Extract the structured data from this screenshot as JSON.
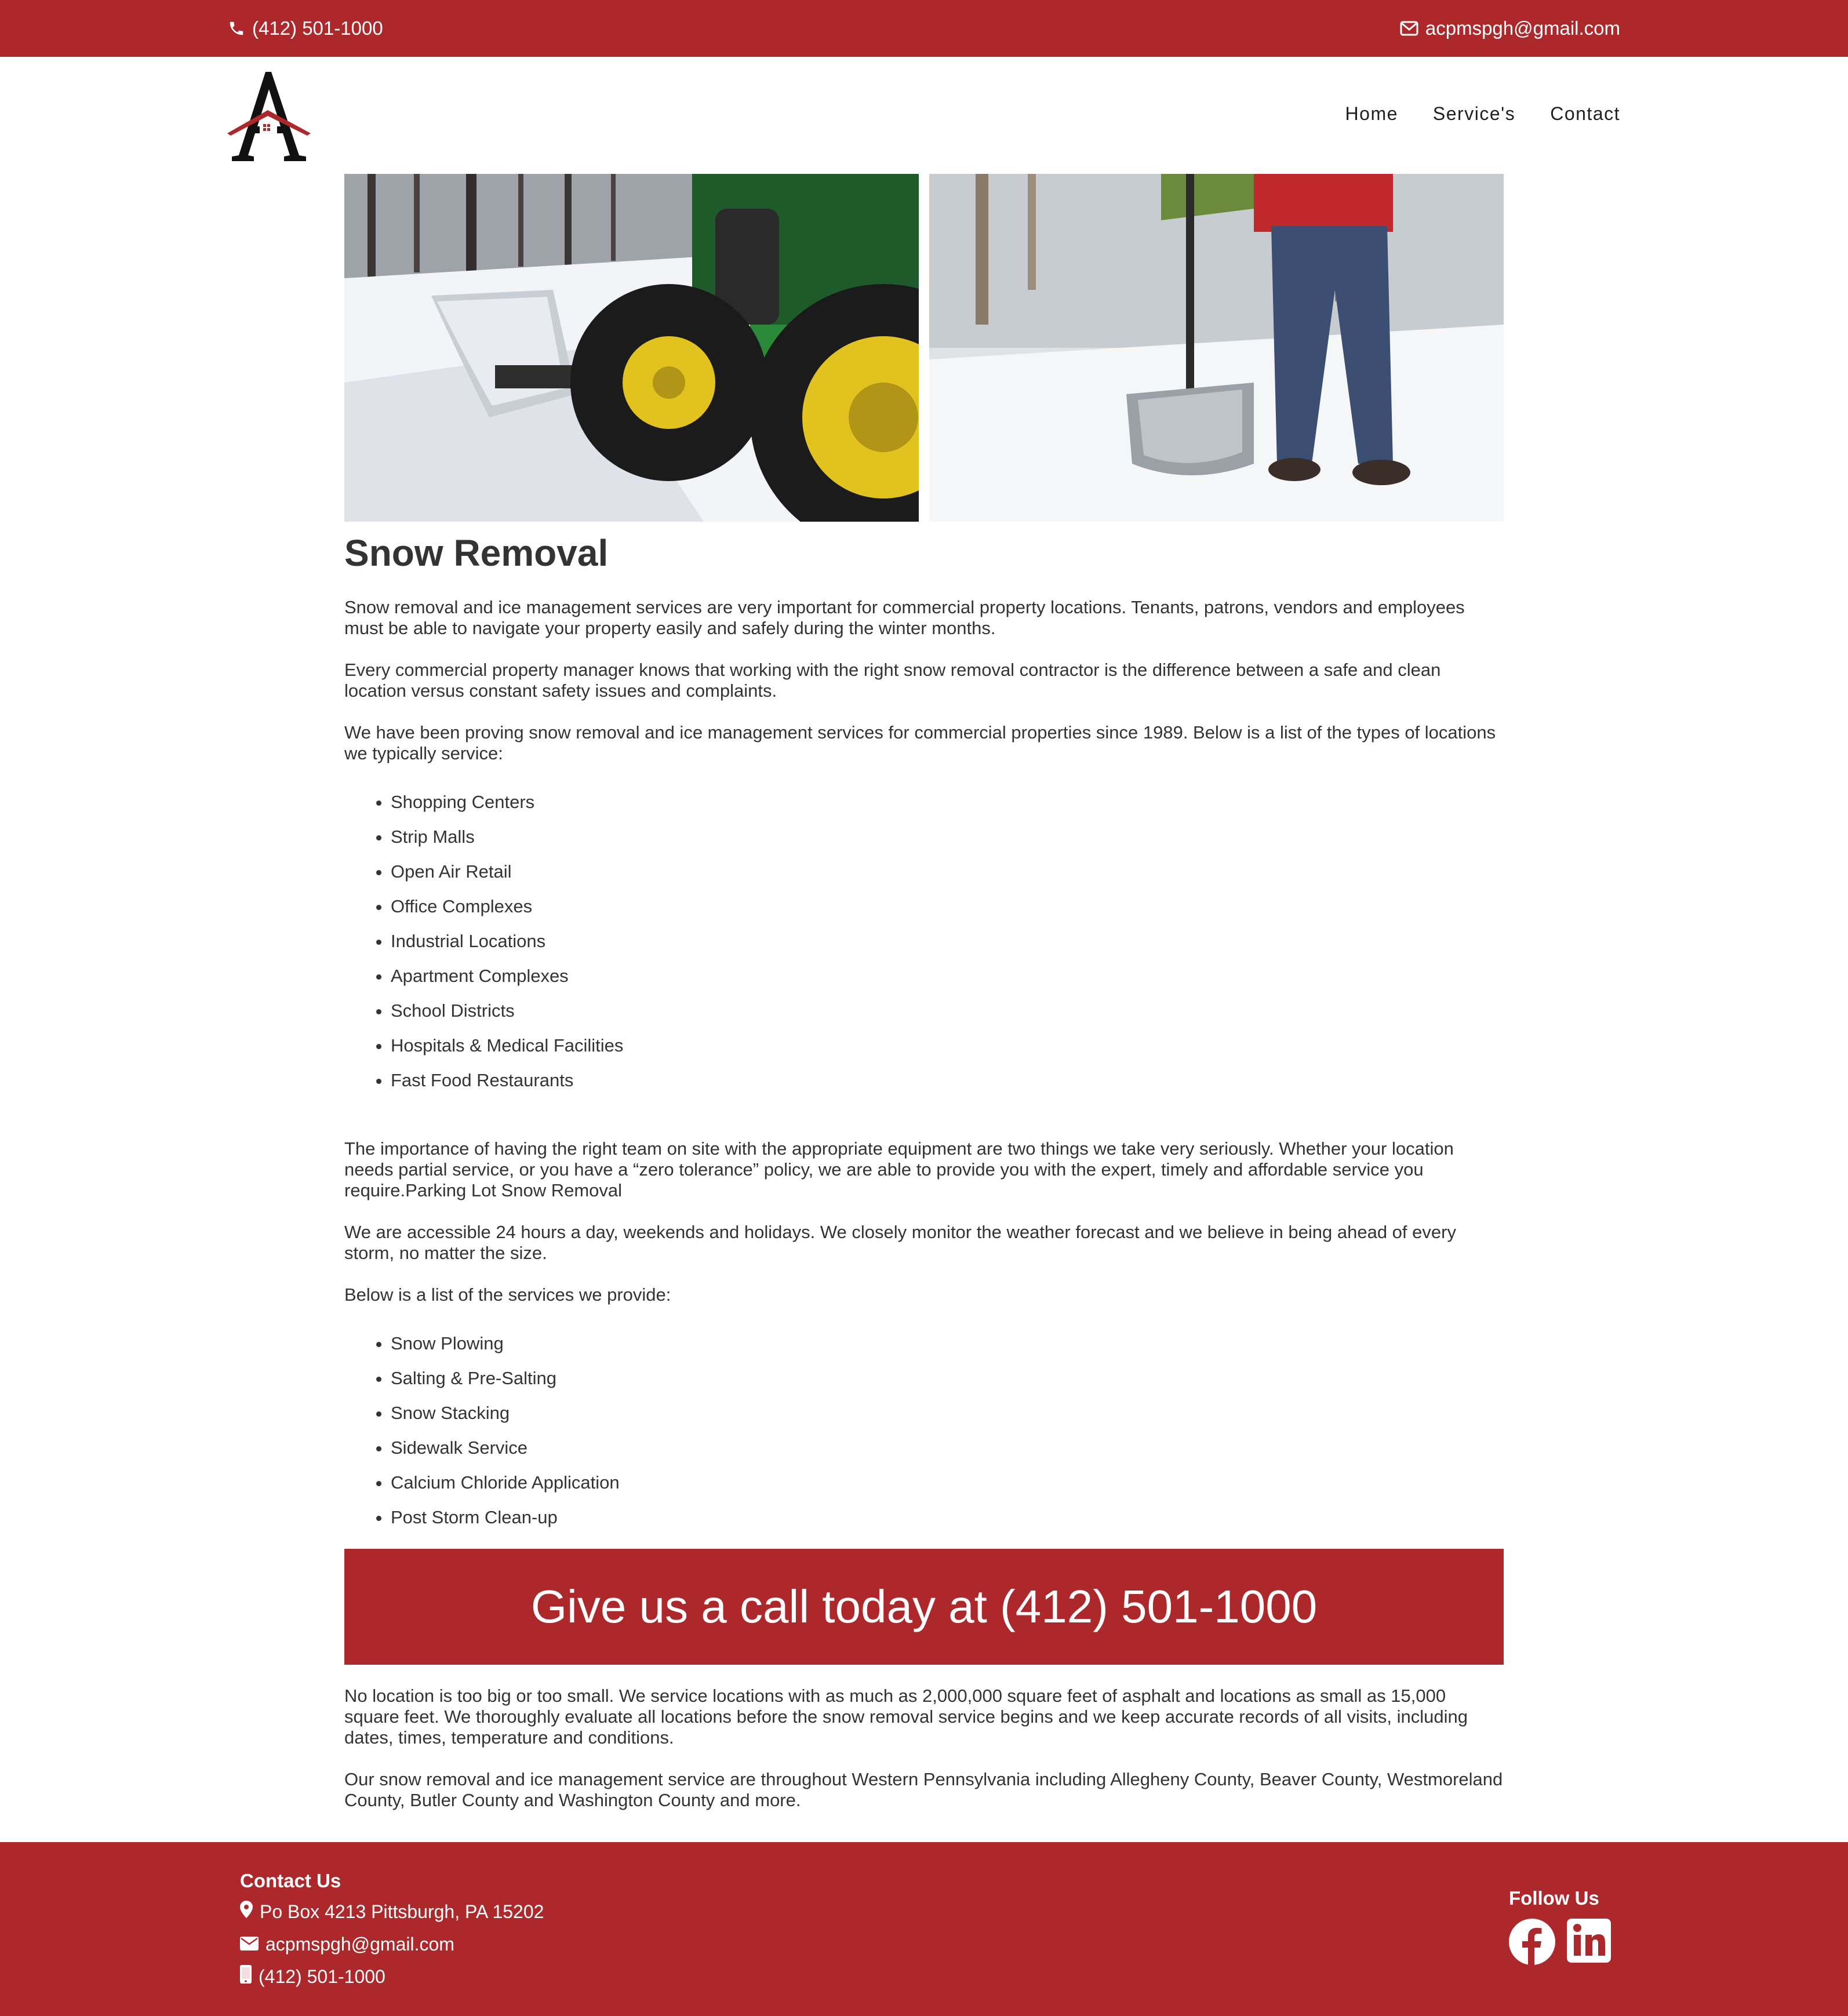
{
  "topbar": {
    "phone": "(412) 501-1000",
    "email": "acpmspgh@gmail.com",
    "phone_icon": "phone-icon",
    "email_icon": "envelope-icon",
    "background": "#ac282b"
  },
  "header": {
    "logo_icon": "letter-a-house-logo",
    "nav": [
      {
        "label": "Home"
      },
      {
        "label": "Service's"
      },
      {
        "label": "Contact"
      }
    ]
  },
  "hero": {
    "left_image": "snow plow tractor photo",
    "right_image": "person with snow shovel photo"
  },
  "main": {
    "title": "Snow Removal",
    "paragraphs_intro": [
      "Snow removal and ice management services are very important for commercial property locations. Tenants, patrons, vendors and employees must be able to navigate your property easily and safely during the winter months.",
      "Every commercial property manager knows that working with the right snow removal contractor is the difference between a safe and clean location versus constant safety issues and complaints.",
      "We have been proving snow removal and ice management services for commercial properties since 1989. Below is a list of the types of locations we typically service:"
    ],
    "locations": [
      "Shopping Centers",
      "Strip Malls",
      "Open Air Retail",
      "Office Complexes",
      "Industrial Locations",
      "Apartment Complexes",
      "School Districts",
      "Hospitals & Medical Facilities",
      "Fast Food Restaurants"
    ],
    "paragraphs_middle": [
      "The importance of having the right team on site with the appropriate equipment are two things we take very seriously. Whether your location needs partial service, or you have a “zero tolerance” policy, we are able to provide you with the expert, timely and affordable service you require.Parking Lot Snow Removal",
      "We are accessible 24 hours a day, weekends and holidays. We closely monitor the weather forecast and we believe in being ahead of every storm, no matter the size.",
      "Below is a list of the services we provide:"
    ],
    "services": [
      "Snow Plowing",
      "Salting & Pre-Salting",
      "Snow Stacking",
      "Sidewalk Service",
      "Calcium Chloride Application",
      "Post Storm Clean-up"
    ],
    "cta": "Give us a call today at (412) 501-1000",
    "paragraphs_end": [
      "No location is too big or too small. We service locations with as much as 2,000,000 square feet of asphalt and locations as small as 15,000 square feet. We thoroughly evaluate all locations before the snow removal service begins and we keep accurate records of all visits, including dates, times, temperature and conditions.",
      "Our snow removal and ice management service are throughout Western Pennsylvania including Allegheny County, Beaver County, Westmoreland County, Butler County and Washington County and more."
    ]
  },
  "footer": {
    "contact_heading": "Contact Us",
    "address": "Po Box 4213 Pittsburgh, PA 15202",
    "email": "acpmspgh@gmail.com",
    "phone": "(412) 501-1000",
    "follow_heading": "Follow Us",
    "social": [
      "facebook-icon",
      "linkedin-icon"
    ]
  }
}
